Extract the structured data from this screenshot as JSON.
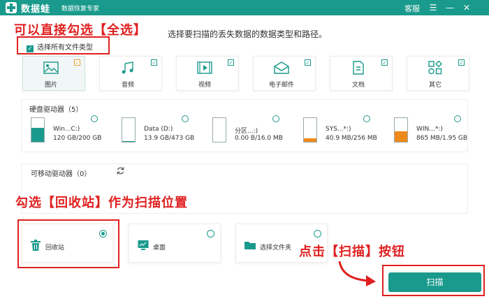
{
  "app": {
    "name": "数据蛙",
    "tagline": "数据恢复专家"
  },
  "titlebar": {
    "service": "客服",
    "menu": "☰",
    "minimize": "—",
    "close": "✕"
  },
  "annotations": {
    "select_all_tip": "可以直接勾选【全选】",
    "recycle_tip": "勾选【回收站】作为扫描位置",
    "scan_tip": "点击【扫描】按钮"
  },
  "instruction": "选择要扫描的丢失数据的数据类型和路径。",
  "select_all": {
    "label": "选择所有文件类型",
    "checked": true
  },
  "file_types": [
    {
      "label": "图片",
      "icon": "image-icon",
      "checked": true
    },
    {
      "label": "音频",
      "icon": "music-icon",
      "checked": true
    },
    {
      "label": "视频",
      "icon": "video-icon",
      "checked": true
    },
    {
      "label": "电子邮件",
      "icon": "mail-icon",
      "checked": true
    },
    {
      "label": "文档",
      "icon": "document-icon",
      "checked": true
    },
    {
      "label": "其它",
      "icon": "other-icon",
      "checked": true
    }
  ],
  "hard_drives": {
    "title": "硬盘驱动器（5）",
    "items": [
      {
        "name": "Win...C:)",
        "size": "120 GB/200 GB",
        "used_fraction": 0.6,
        "color": "#1a9a8c",
        "icon": "windows-drive-icon"
      },
      {
        "name": "Data (D:)",
        "size": "13.9 GB/473 GB",
        "used_fraction": 0.03,
        "color": "#1a9a8c",
        "icon": "drive-icon"
      },
      {
        "name": "分区...:)",
        "size": "0.00  B/16.0 MB",
        "used_fraction": 0.0,
        "color": "#1a9a8c",
        "icon": "drive-icon"
      },
      {
        "name": "SYS...*:)",
        "size": "40.9 MB/256 MB",
        "used_fraction": 0.16,
        "color": "#ee8a1a",
        "icon": "drive-icon"
      },
      {
        "name": "WIN...*:)",
        "size": "865 MB/1.95 GB",
        "used_fraction": 0.44,
        "color": "#ee8a1a",
        "icon": "drive-icon"
      }
    ]
  },
  "removable": {
    "title": "可移动驱动器（0）"
  },
  "locations": [
    {
      "label": "回收站",
      "icon": "trash-icon",
      "selected": true
    },
    {
      "label": "桌面",
      "icon": "desktop-icon",
      "selected": false
    },
    {
      "label": "选择文件夹",
      "icon": "folder-icon",
      "selected": false
    }
  ],
  "scan_button": {
    "label": "扫描"
  },
  "colors": {
    "accent": "#1a9a8c",
    "annotation": "#e02020",
    "warning": "#ee8a1a"
  }
}
